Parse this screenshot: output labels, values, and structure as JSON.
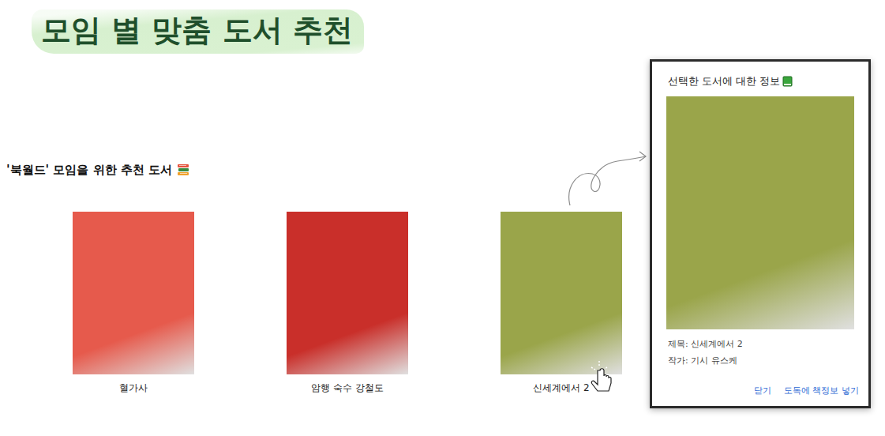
{
  "page": {
    "title": "모임 별 맞춤 도서 추천"
  },
  "section": {
    "title": "'북월드' 모임을 위한 추천 도서"
  },
  "books": [
    {
      "title": "혈가사",
      "color": "#e65a4c",
      "selected": false
    },
    {
      "title": "암행 숙수 강철도",
      "color": "#c92f2a",
      "selected": false
    },
    {
      "title": "신세계에서 2",
      "color": "#9aa54a",
      "selected": true
    }
  ],
  "dialog": {
    "title": "선택한 도서에 대한 정보",
    "lines": [
      "제목: 신세계에서 2",
      "작가: 기시 유스케"
    ],
    "buttons": [
      "닫기",
      "도독에 책정보 넣기"
    ]
  }
}
